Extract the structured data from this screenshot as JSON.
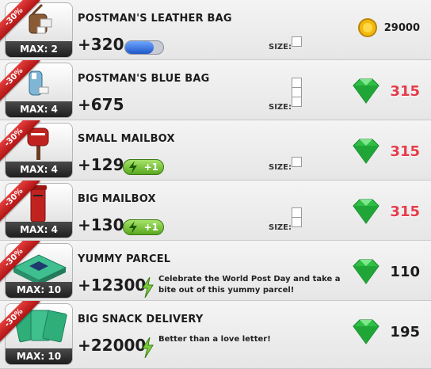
{
  "items": [
    {
      "title": "POSTMAN'S LEATHER BAG",
      "amount": "+320",
      "max": "MAX: 2",
      "discount": "-30%",
      "bar": "pill",
      "size_label": "SIZE:",
      "size_slots": 1,
      "price": "29000",
      "currency": "coin"
    },
    {
      "title": "POSTMAN'S BLUE BAG",
      "amount": "+675",
      "max": "MAX: 4",
      "discount": "-30%",
      "bar": "none",
      "size_label": "SIZE:",
      "size_slots": 3,
      "price": "315",
      "currency": "gem",
      "price_color": "red"
    },
    {
      "title": "SMALL MAILBOX",
      "amount": "+129",
      "max": "MAX: 4",
      "discount": "-30%",
      "bar": "energy",
      "energy": "+1",
      "size_label": "SIZE:",
      "size_slots": 1,
      "price": "315",
      "currency": "gem",
      "price_color": "red"
    },
    {
      "title": "BIG MAILBOX",
      "amount": "+130",
      "max": "MAX: 4",
      "discount": "-30%",
      "bar": "energy",
      "energy": "+1",
      "size_label": "SIZE:",
      "size_slots": 2,
      "price": "315",
      "currency": "gem",
      "price_color": "red"
    },
    {
      "title": "YUMMY PARCEL",
      "amount": "+12300",
      "max": "MAX: 10",
      "discount": "-30%",
      "bar": "bolt",
      "desc": "Celebrate the World Post Day and take a bite out of this yummy parcel!",
      "price": "110",
      "currency": "gem",
      "price_color": "dark"
    },
    {
      "title": "BIG SNACK DELIVERY",
      "amount": "+22000",
      "max": "MAX: 10",
      "discount": "-30%",
      "bar": "bolt",
      "desc": "Better than a love letter!",
      "price": "195",
      "currency": "gem",
      "price_color": "dark"
    }
  ],
  "colors": {
    "gem": "#2fbf44",
    "coin": "#f2b90c",
    "ribbon": "#c81e1e"
  },
  "pill_fill": 0.75
}
